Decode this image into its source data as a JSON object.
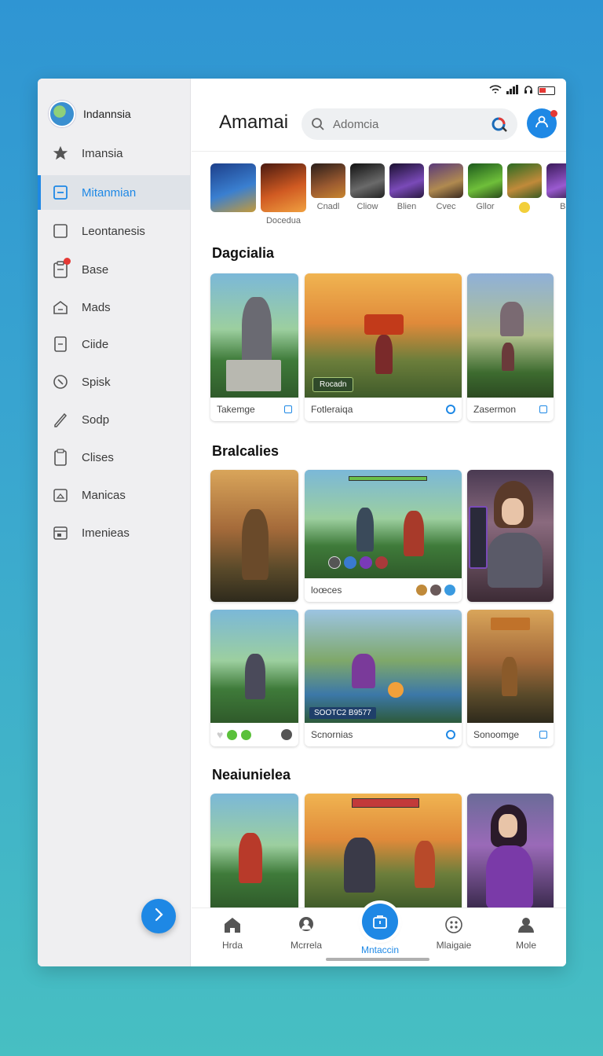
{
  "sidebar": {
    "header": "Indannsia",
    "items": [
      {
        "label": "Imansia",
        "icon": "star-icon"
      },
      {
        "label": "Mitanmian",
        "icon": "square-icon",
        "active": true
      },
      {
        "label": "Leontanesis",
        "icon": "square-outline-icon"
      },
      {
        "label": "Base",
        "icon": "clipboard-icon",
        "badge": true
      },
      {
        "label": "Mads",
        "icon": "home-icon"
      },
      {
        "label": "Ciide",
        "icon": "doc-icon"
      },
      {
        "label": "Spisk",
        "icon": "compass-icon"
      },
      {
        "label": "Sodp",
        "icon": "pen-icon"
      },
      {
        "label": "Clises",
        "icon": "clipboard-list-icon"
      },
      {
        "label": "Manicas",
        "icon": "image-icon"
      },
      {
        "label": "Imenieas",
        "icon": "calendar-icon"
      }
    ]
  },
  "header": {
    "title": "Amamai",
    "search_placeholder": "Adomcia"
  },
  "strip": [
    {
      "label": ""
    },
    {
      "label": "Docedua"
    },
    {
      "label": "Cnadl"
    },
    {
      "label": "Cliow"
    },
    {
      "label": "Blien"
    },
    {
      "label": "Cvec"
    },
    {
      "label": "Gllor"
    },
    {
      "label": ""
    },
    {
      "label": "Bi"
    }
  ],
  "sections": [
    {
      "title": "Dagcialia"
    },
    {
      "title": "Bralcalies"
    },
    {
      "title": "Neaiunielea"
    }
  ],
  "cards": {
    "s1": [
      {
        "caption": "Takemge"
      },
      {
        "caption": "Fotleraiqa",
        "button": "Rocadn"
      },
      {
        "caption": "Zasermon"
      }
    ],
    "s2": [
      {
        "caption": "loœces"
      },
      {
        "caption": "Scnornias",
        "hud": "SOOTC2 B9577"
      },
      {
        "caption": "Sonoomge"
      }
    ]
  },
  "tabs": [
    {
      "label": "Hrda",
      "icon": "home-icon"
    },
    {
      "label": "Mcrrela",
      "icon": "person-pin-icon"
    },
    {
      "label": "Mntaccin",
      "icon": "bag-icon",
      "active": true
    },
    {
      "label": "Mlaigaie",
      "icon": "grid-dots-icon"
    },
    {
      "label": "Mole",
      "icon": "person-icon"
    }
  ],
  "colors": {
    "accent": "#1e88e5",
    "badge": "#e53935",
    "background": "#3aa7cf"
  }
}
